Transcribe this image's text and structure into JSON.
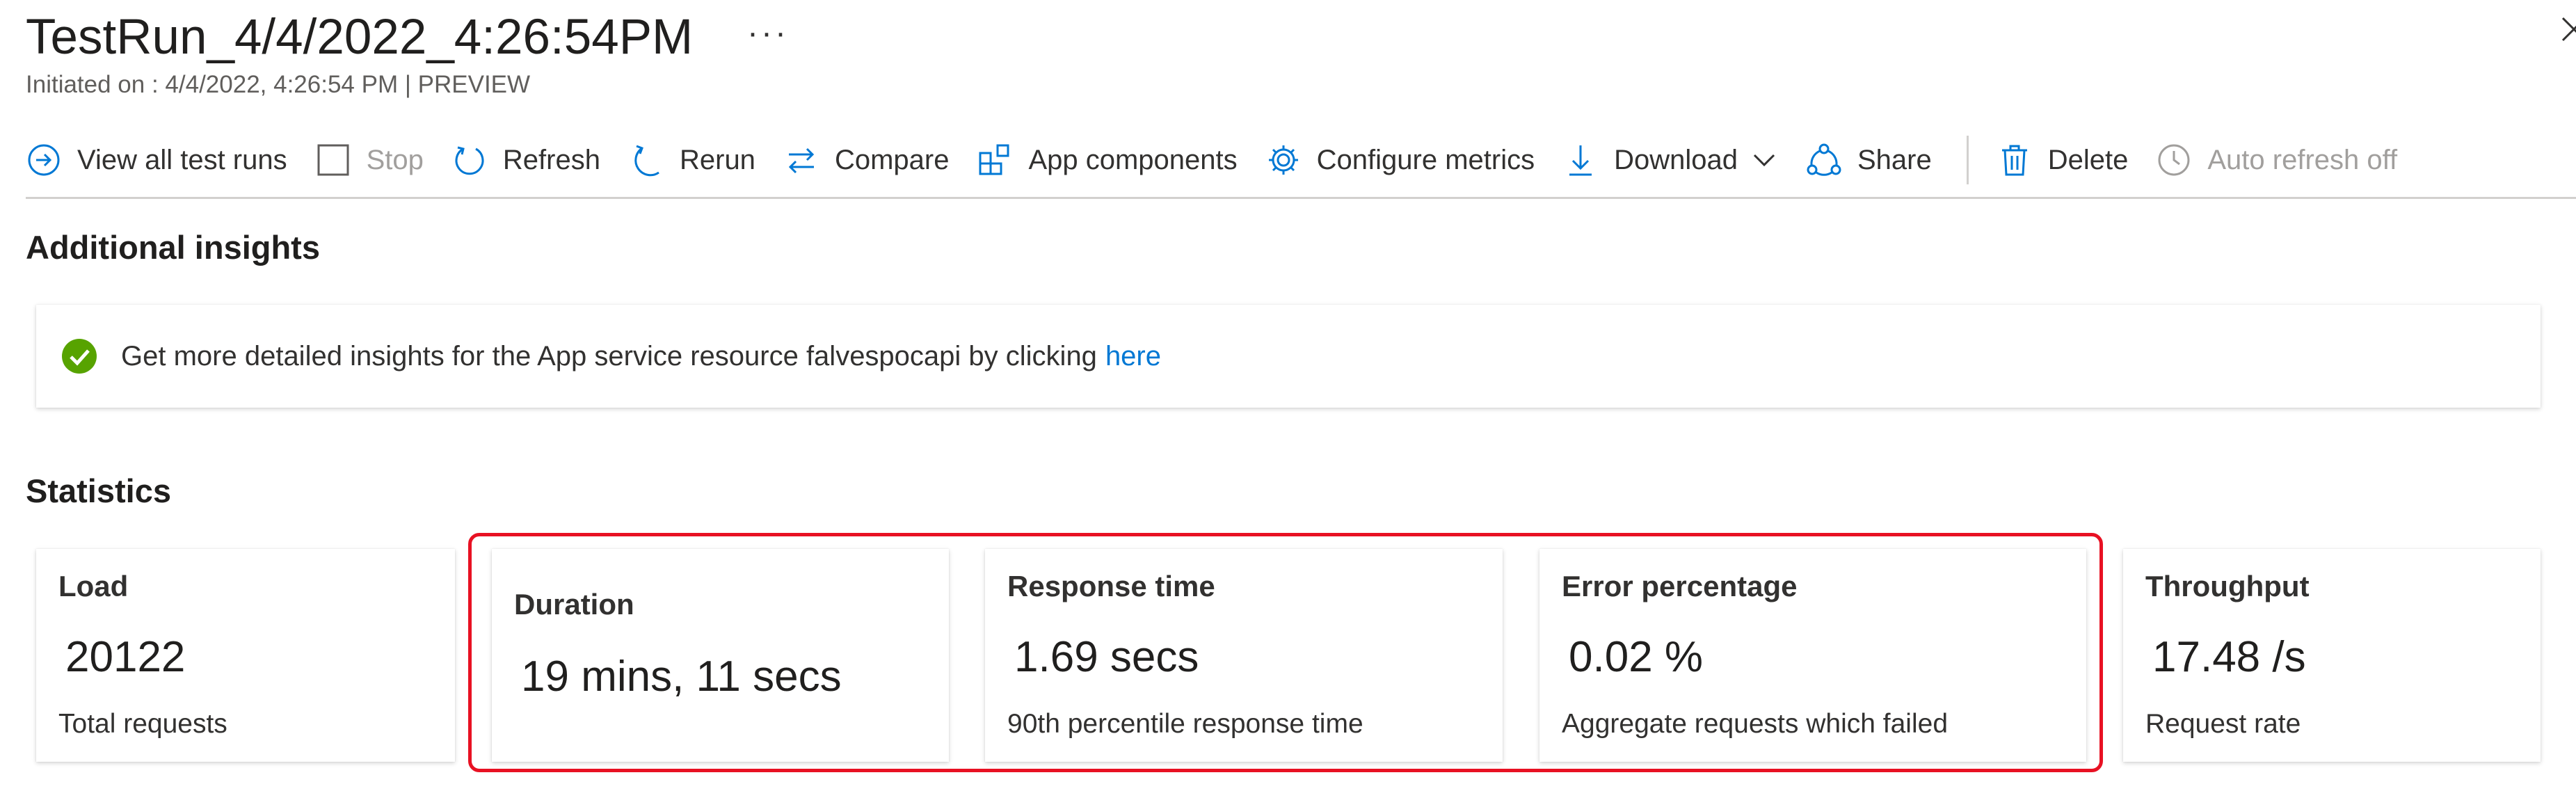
{
  "header": {
    "title": "TestRun_4/4/2022_4:26:54PM",
    "more_label": "···",
    "subtitle": "Initiated on : 4/4/2022, 4:26:54 PM | PREVIEW"
  },
  "toolbar": {
    "view_all": "View all test runs",
    "stop": "Stop",
    "refresh": "Refresh",
    "rerun": "Rerun",
    "compare": "Compare",
    "app_components": "App components",
    "configure_metrics": "Configure metrics",
    "download": "Download",
    "share": "Share",
    "delete": "Delete",
    "auto_refresh": "Auto refresh off"
  },
  "insights": {
    "title": "Additional insights",
    "message": "Get more detailed insights for the App service resource falvespocapi by clicking",
    "link": "here"
  },
  "statistics": {
    "title": "Statistics",
    "cards": [
      {
        "label": "Load",
        "value": "20122",
        "desc": "Total requests"
      },
      {
        "label": "Duration",
        "value": "19 mins, 11 secs",
        "desc": ""
      },
      {
        "label": "Response time",
        "value": "1.69 secs",
        "desc": "90th percentile response time"
      },
      {
        "label": "Error percentage",
        "value": "0.02 %",
        "desc": "Aggregate requests which failed"
      },
      {
        "label": "Throughput",
        "value": "17.48 /s",
        "desc": "Request rate"
      }
    ]
  },
  "colors": {
    "accent": "#0078d4",
    "success": "#57a300",
    "highlight": "#e81123",
    "disabled": "#a19f9d"
  }
}
